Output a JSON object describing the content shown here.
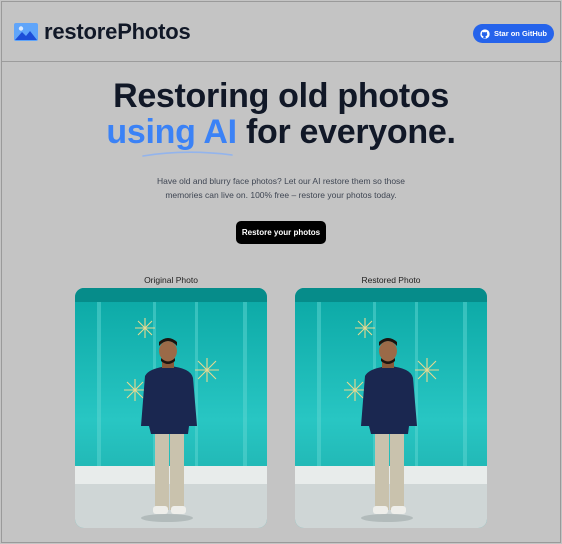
{
  "header": {
    "brand": "restorePhotos",
    "github_button": "Star on GitHub",
    "logo_icon": "photo-icon",
    "github_icon": "github-icon"
  },
  "hero": {
    "title_line1": "Restoring old photos",
    "title_accent": "using AI",
    "title_rest": " for everyone.",
    "description": "Have old and blurry face photos? Let our AI restore them so those memories can live on. 100% free – restore your photos today.",
    "cta": "Restore your photos"
  },
  "comparison": {
    "original_label": "Original Photo",
    "restored_label": "Restored Photo"
  },
  "colors": {
    "background": "#c4c4c4",
    "accent": "#3b82f6",
    "github_button": "#2563eb",
    "cta": "#000000"
  }
}
